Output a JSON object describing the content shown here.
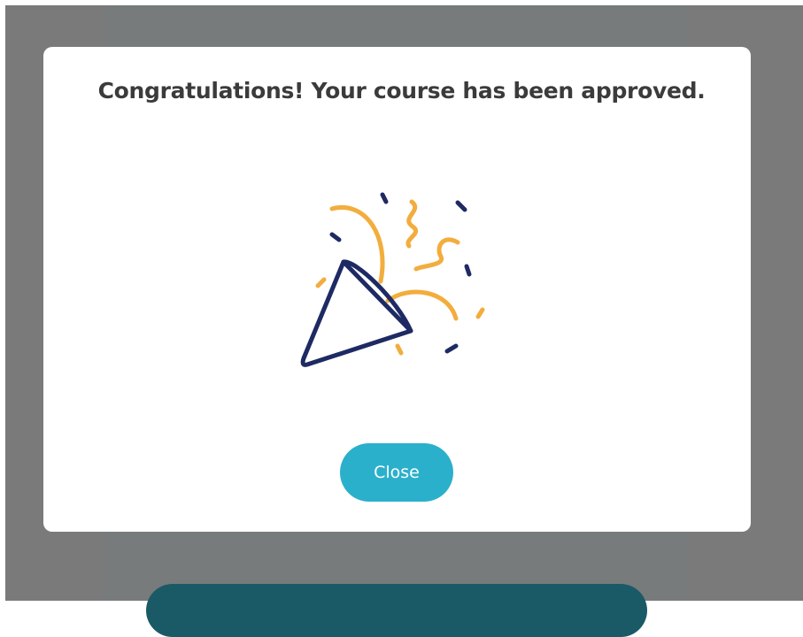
{
  "modal": {
    "title": "Congratulations! Your course has been approved.",
    "illustration_icon": "party-popper-icon",
    "close_label": "Close"
  },
  "colors": {
    "overlay": "#7a7a7a",
    "modal_background": "#ffffff",
    "title_text": "#3b3b3b",
    "close_button": "#2bb0cb",
    "popper_outline": "#1e2a63",
    "confetti": "#f2ad3d",
    "background_button": "#1a5a66"
  }
}
